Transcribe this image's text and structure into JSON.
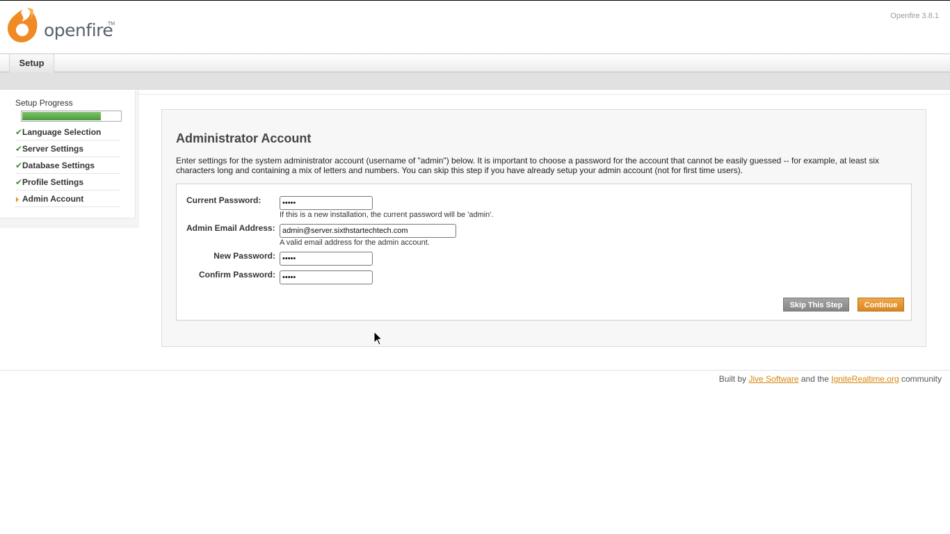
{
  "app": {
    "logo_text": "openfire",
    "logo_tm": "TM",
    "version": "Openfire 3.8.1"
  },
  "tabs": [
    {
      "label": "Setup"
    }
  ],
  "sidebar": {
    "progress_label": "Setup Progress",
    "progress": 0.8,
    "items": [
      {
        "label": "Language Selection",
        "status": "done"
      },
      {
        "label": "Server Settings",
        "status": "done"
      },
      {
        "label": "Database Settings",
        "status": "done"
      },
      {
        "label": "Profile Settings",
        "status": "done"
      },
      {
        "label": "Admin Account",
        "status": "current"
      }
    ]
  },
  "main": {
    "title": "Administrator Account",
    "description": "Enter settings for the system administrator account (username of \"admin\") below. It is important to choose a password for the account that cannot be easily guessed -- for example, at least six characters long and containing a mix of letters and numbers. You can skip this step if you have already setup your admin account (not for first time users).",
    "form": {
      "current_password": {
        "label": "Current Password:",
        "value": "•••••",
        "help": "If this is a new installation, the current password will be 'admin'."
      },
      "email": {
        "label": "Admin Email Address:",
        "value": "admin@server.sixthstartechtech.com",
        "help": "A valid email address for the admin account."
      },
      "new_password": {
        "label": "New Password:",
        "value": "•••••"
      },
      "confirm_password": {
        "label": "Confirm Password:",
        "value": "•••••"
      }
    },
    "buttons": {
      "skip": "Skip This Step",
      "continue": "Continue"
    }
  },
  "footer": {
    "prefix": "Built by",
    "link1": "Jive Software",
    "middle": "and the",
    "link2": "IgniteRealtime.org",
    "suffix": "community"
  },
  "colors": {
    "accent": "#e3932a",
    "progress": "#5aa848",
    "check": "#3f8d2f",
    "link": "#d4860b"
  }
}
